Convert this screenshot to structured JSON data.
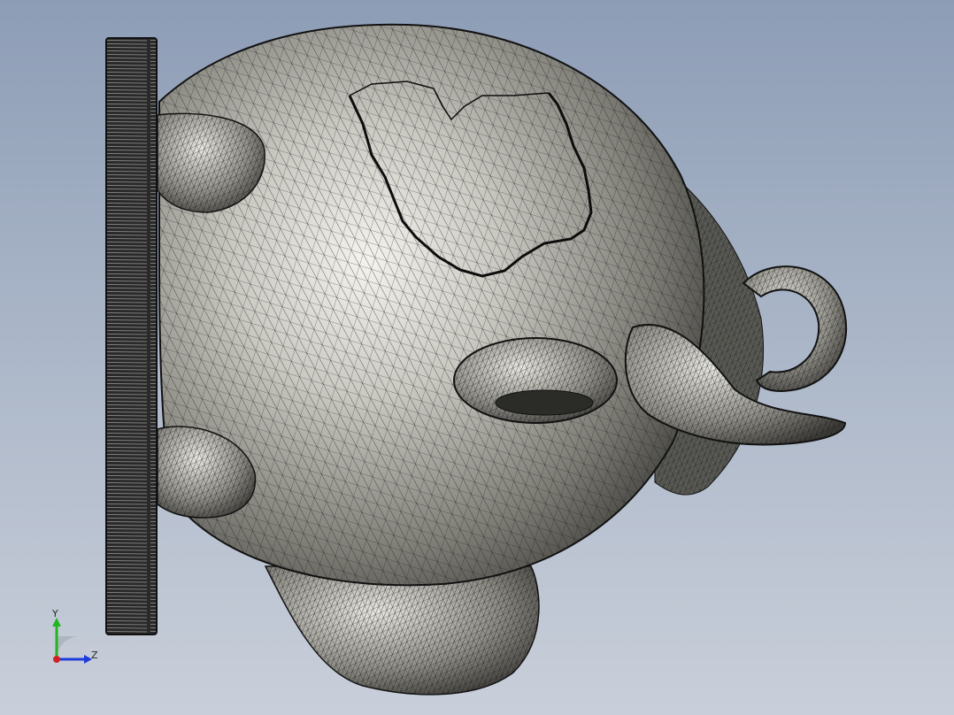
{
  "viewport": {
    "model": "mesh-sphere-figure",
    "background_top": "#8d9db6",
    "background_bottom": "#c9cfda",
    "mesh_color": "#1a1a1a",
    "surface_light": "#f2f1ec",
    "surface_dark": "#4b4a45"
  },
  "triad": {
    "y_label": "Y",
    "z_label": "Z",
    "y_color": "#22b422",
    "z_color": "#1e3cdc",
    "x_color": "#d42020"
  }
}
